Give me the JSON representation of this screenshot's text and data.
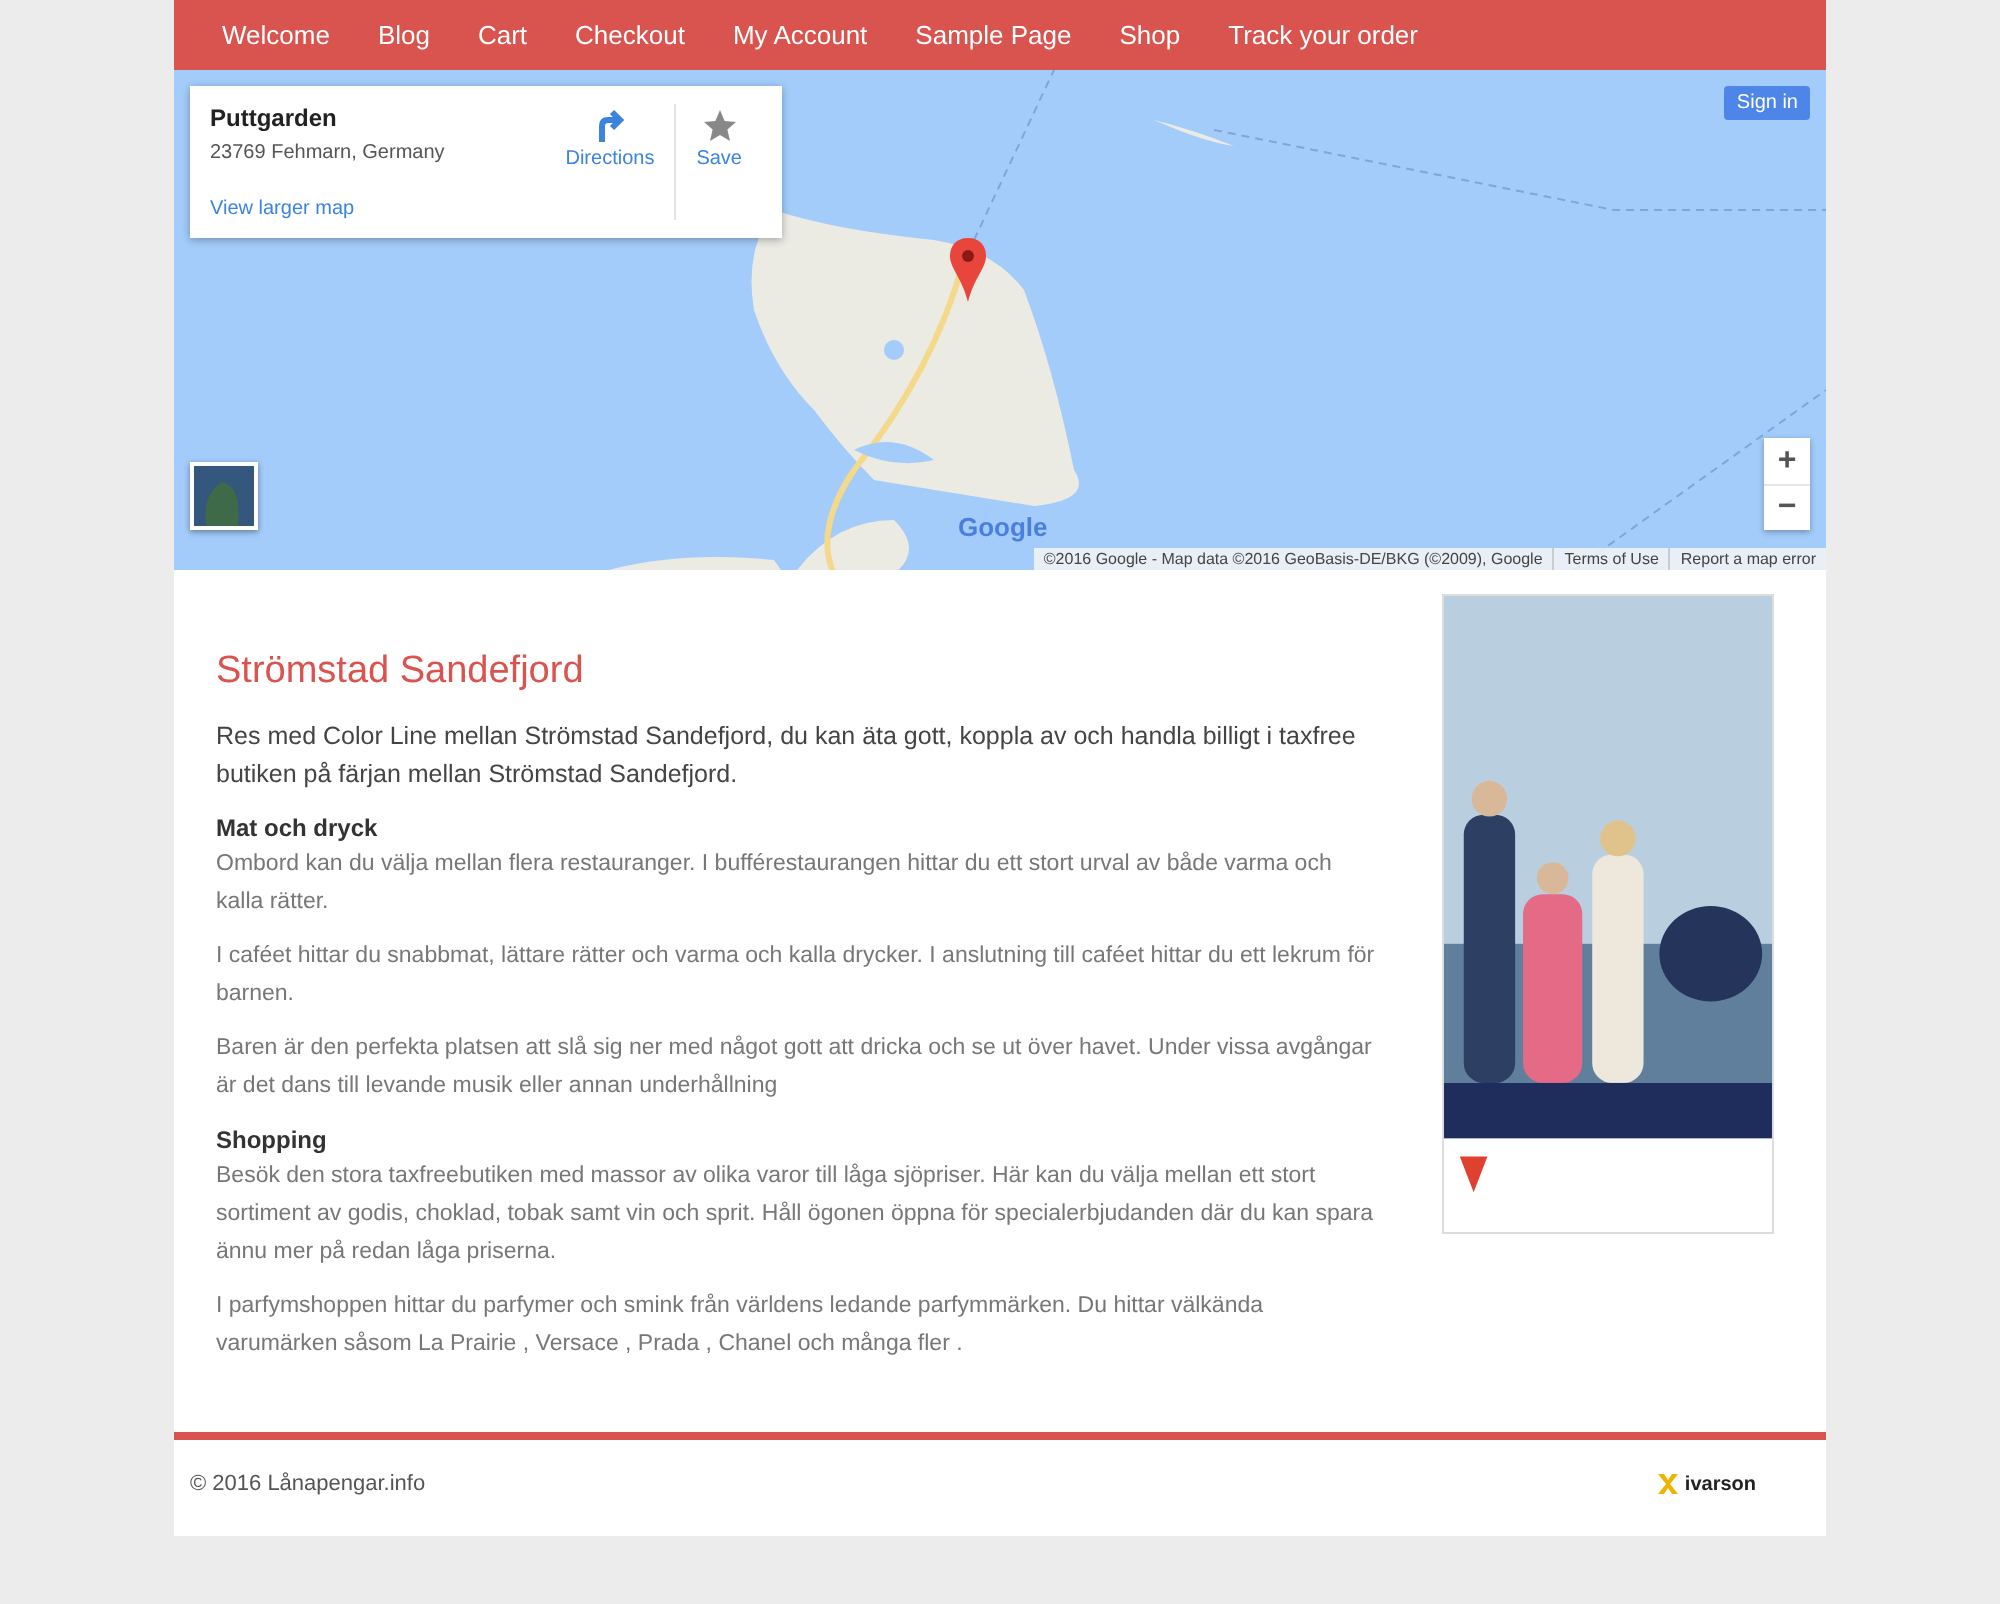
{
  "nav": [
    {
      "label": "Welcome"
    },
    {
      "label": "Blog"
    },
    {
      "label": "Cart"
    },
    {
      "label": "Checkout"
    },
    {
      "label": "My Account"
    },
    {
      "label": "Sample Page"
    },
    {
      "label": "Shop"
    },
    {
      "label": "Track your order"
    }
  ],
  "map": {
    "place": {
      "name": "Puttgarden",
      "address": "23769 Fehmarn, Germany",
      "directions": "Directions",
      "save": "Save",
      "larger_link": "View larger map"
    },
    "sign_in": "Sign in",
    "zoom_in": "+",
    "zoom_out": "−",
    "logo": "Google",
    "attribution": [
      "©2016 Google - Map data ©2016 GeoBasis-DE/BKG (©2009), Google",
      "Terms of Use",
      "Report a map error"
    ]
  },
  "article": {
    "title": "Strömstad Sandefjord",
    "blocks": [
      {
        "kind": "lead",
        "text": "Res med Color Line mellan Strömstad Sandefjord, du kan äta gott, koppla av och handla billigt i taxfree butiken på färjan mellan Strömstad Sandefjord."
      },
      {
        "kind": "heading",
        "text": "Mat och dryck"
      },
      {
        "kind": "para",
        "text": "Ombord kan du välja mellan flera restauranger. I bufférestaurangen hittar du ett stort urval av både varma och kalla rätter."
      },
      {
        "kind": "para",
        "text": "I caféet hittar du snabbmat, lättare rätter och varma och kalla drycker. I anslutning till caféet hittar du ett lekrum för barnen."
      },
      {
        "kind": "para",
        "text": "Baren är den perfekta platsen att slå sig ner med något gott att dricka och se ut över havet. Under vissa avgångar är det dans till levande musik eller annan underhållning"
      },
      {
        "kind": "heading",
        "text": "Shopping"
      },
      {
        "kind": "para",
        "text": "Besök den stora taxfreebutiken med massor av olika varor till låga sjöpriser. Här kan du välja mellan ett stort sortiment av godis, choklad, tobak samt vin och sprit. Håll ögonen öppna för specialerbjudanden där du kan spara ännu mer på redan låga priserna."
      },
      {
        "kind": "para",
        "text": "I parfymshoppen hittar du parfymer och smink från världens ledande parfymmärken. Du hittar välkända varumärken såsom La Prairie , Versace , Prada , Chanel och många fler ."
      }
    ]
  },
  "footer": {
    "copyright": "© 2016 Lånapengar.info",
    "brand": "ivarson"
  }
}
